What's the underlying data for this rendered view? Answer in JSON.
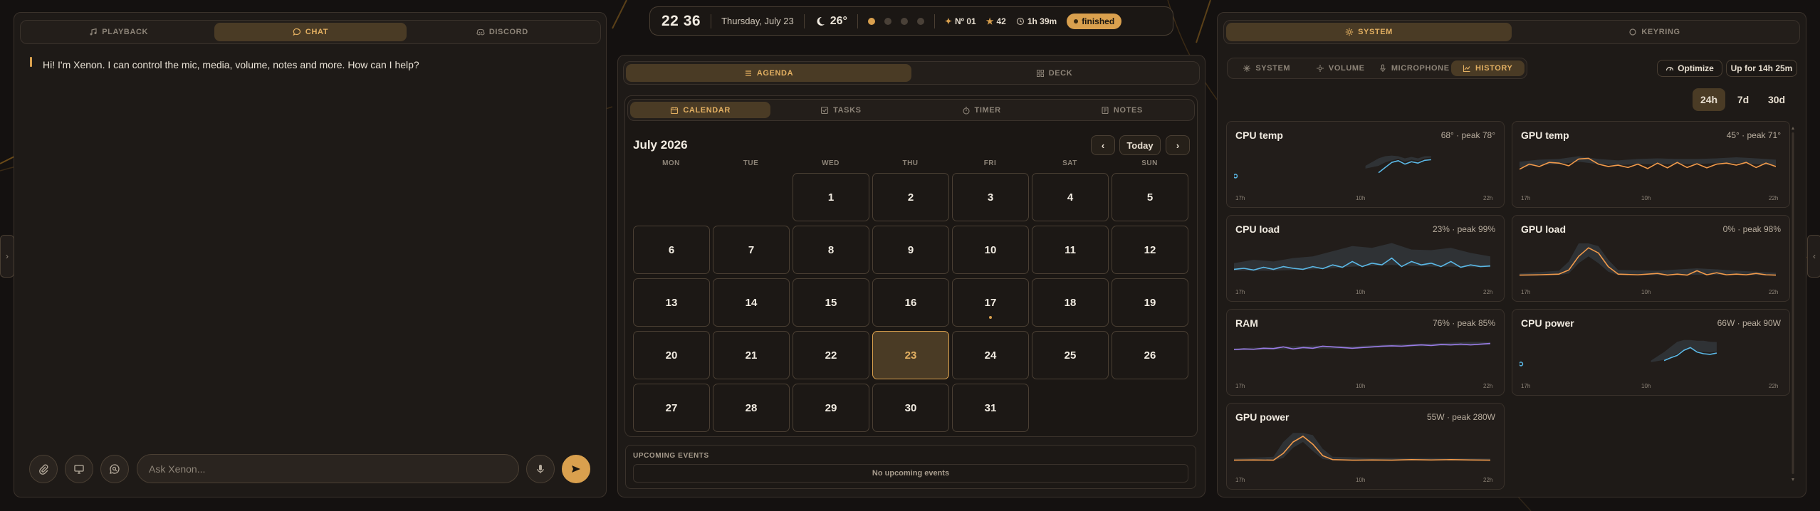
{
  "topbar": {
    "time": "22 36",
    "date": "Thursday, July 23",
    "weather_icon": "moon-icon",
    "temperature": "26°",
    "dots": [
      true,
      false,
      false,
      false
    ],
    "rank_label": "Nº 01",
    "stars_label": "42",
    "timer_label": "1h 39m",
    "status_label": "finished"
  },
  "chat_panel": {
    "tabs": [
      {
        "label": "PLAYBACK",
        "icon": "music-icon",
        "active": false
      },
      {
        "label": "CHAT",
        "icon": "chat-icon",
        "active": true
      },
      {
        "label": "DISCORD",
        "icon": "discord-icon",
        "active": false
      }
    ],
    "message": "Hi! I'm Xenon. I can control the mic, media, volume, notes and more. How can I help?",
    "input_placeholder": "Ask Xenon..."
  },
  "agenda_panel": {
    "tabs": [
      {
        "label": "AGENDA",
        "icon": "list-icon",
        "active": true
      },
      {
        "label": "DECK",
        "icon": "grid-icon",
        "active": false
      }
    ],
    "subtabs": [
      {
        "label": "CALENDAR",
        "icon": "calendar-icon",
        "active": true
      },
      {
        "label": "TASKS",
        "icon": "check-square-icon",
        "active": false
      },
      {
        "label": "TIMER",
        "icon": "stopwatch-icon",
        "active": false
      },
      {
        "label": "NOTES",
        "icon": "notes-icon",
        "active": false
      }
    ],
    "calendar": {
      "month_label": "July 2026",
      "today_button": "Today",
      "weekdays": [
        "MON",
        "TUE",
        "WED",
        "THU",
        "FRI",
        "SAT",
        "SUN"
      ],
      "first_weekday_index": 2,
      "days_in_month": 31,
      "today": 23,
      "event_days": [
        17
      ]
    },
    "upcoming": {
      "header": "UPCOMING EVENTS",
      "empty_text": "No upcoming events"
    }
  },
  "system_panel": {
    "tabs": [
      {
        "label": "SYSTEM",
        "icon": "gear-icon",
        "active": true
      },
      {
        "label": "KEYRING",
        "icon": "keyring-icon",
        "active": false
      }
    ],
    "subtabs": [
      {
        "label": "SYSTEM",
        "icon": "sparkle-icon",
        "active": false
      },
      {
        "label": "VOLUME",
        "icon": "volume-icon",
        "active": false
      },
      {
        "label": "MICROPHONE",
        "icon": "mic-icon",
        "active": false
      },
      {
        "label": "HISTORY",
        "icon": "chart-icon",
        "active": true
      }
    ],
    "optimize_label": "Optimize",
    "uptime_label": "Up for 14h 25m",
    "ranges": [
      {
        "label": "24h",
        "active": true
      },
      {
        "label": "7d",
        "active": false
      },
      {
        "label": "30d",
        "active": false
      }
    ],
    "accent": "#d9a04e",
    "series_colors": {
      "blue": "#5bb8e6",
      "orange": "#f29a4a",
      "purple": "#9b7be6"
    }
  },
  "chart_data": [
    {
      "type": "area",
      "title": "CPU temp",
      "summary": "68° · peak 78°",
      "color": "#5bb8e6",
      "xticks": [
        "17h",
        "10h",
        "22h"
      ],
      "ylim": [
        0,
        100
      ],
      "values": [
        null,
        null,
        null,
        null,
        null,
        null,
        null,
        null,
        null,
        null,
        null,
        null,
        null,
        null,
        null,
        null,
        null,
        null,
        null,
        null,
        null,
        null,
        null,
        null,
        null,
        null,
        null,
        null,
        null,
        null,
        null,
        null,
        null,
        null,
        null,
        null,
        null,
        null,
        null,
        null,
        null,
        null,
        null,
        null,
        null,
        null,
        null,
        null,
        null,
        null,
        null
      ],
      "line": [
        [
          0,
          20
        ],
        [
          40,
          null
        ],
        [
          44,
          30
        ],
        [
          46,
          45
        ],
        [
          48,
          60
        ],
        [
          50,
          65
        ],
        [
          52,
          55
        ],
        [
          54,
          62
        ],
        [
          56,
          58
        ],
        [
          58,
          66
        ],
        [
          60,
          68
        ]
      ],
      "band": [
        [
          40,
          42,
          50
        ],
        [
          44,
          50,
          72
        ],
        [
          46,
          60,
          78
        ],
        [
          48,
          66,
          80
        ],
        [
          50,
          70,
          78
        ],
        [
          52,
          62,
          72
        ],
        [
          54,
          68,
          76
        ],
        [
          56,
          64,
          72
        ],
        [
          58,
          72,
          78
        ],
        [
          60,
          74,
          78
        ]
      ]
    },
    {
      "type": "area",
      "title": "GPU temp",
      "summary": "45° · peak 71°",
      "color": "#f29a4a",
      "xticks": [
        "17h",
        "10h",
        "22h"
      ],
      "ylim": [
        0,
        100
      ],
      "line": [
        [
          0,
          40
        ],
        [
          3,
          55
        ],
        [
          6,
          48
        ],
        [
          9,
          60
        ],
        [
          12,
          58
        ],
        [
          15,
          50
        ],
        [
          18,
          70
        ],
        [
          21,
          72
        ],
        [
          24,
          55
        ],
        [
          27,
          48
        ],
        [
          30,
          52
        ],
        [
          33,
          45
        ],
        [
          36,
          55
        ],
        [
          39,
          42
        ],
        [
          42,
          58
        ],
        [
          45,
          44
        ],
        [
          48,
          60
        ],
        [
          51,
          45
        ],
        [
          54,
          56
        ],
        [
          57,
          44
        ],
        [
          60,
          55
        ],
        [
          63,
          58
        ],
        [
          66,
          52
        ],
        [
          69,
          60
        ],
        [
          72,
          45
        ],
        [
          75,
          58
        ],
        [
          78,
          48
        ]
      ],
      "band": [
        [
          0,
          45,
          62
        ],
        [
          6,
          52,
          68
        ],
        [
          12,
          55,
          70
        ],
        [
          18,
          62,
          78
        ],
        [
          24,
          55,
          70
        ],
        [
          30,
          52,
          66
        ],
        [
          36,
          55,
          70
        ],
        [
          42,
          55,
          72
        ],
        [
          48,
          55,
          70
        ],
        [
          54,
          55,
          70
        ],
        [
          60,
          58,
          72
        ],
        [
          66,
          58,
          75
        ],
        [
          72,
          55,
          72
        ],
        [
          78,
          50,
          68
        ]
      ]
    },
    {
      "type": "area",
      "title": "CPU load",
      "summary": "23% · peak 99%",
      "color": "#5bb8e6",
      "xticks": [
        "17h",
        "10h",
        "22h"
      ],
      "ylim": [
        0,
        100
      ],
      "line": [
        [
          0,
          22
        ],
        [
          3,
          25
        ],
        [
          6,
          20
        ],
        [
          9,
          28
        ],
        [
          12,
          22
        ],
        [
          15,
          30
        ],
        [
          18,
          25
        ],
        [
          21,
          22
        ],
        [
          24,
          30
        ],
        [
          27,
          24
        ],
        [
          30,
          35
        ],
        [
          33,
          28
        ],
        [
          36,
          45
        ],
        [
          39,
          30
        ],
        [
          42,
          40
        ],
        [
          45,
          35
        ],
        [
          48,
          55
        ],
        [
          51,
          30
        ],
        [
          54,
          45
        ],
        [
          57,
          35
        ],
        [
          60,
          40
        ],
        [
          63,
          30
        ],
        [
          66,
          45
        ],
        [
          69,
          28
        ],
        [
          72,
          35
        ],
        [
          75,
          30
        ],
        [
          78,
          32
        ]
      ],
      "band": [
        [
          0,
          18,
          40
        ],
        [
          6,
          18,
          50
        ],
        [
          12,
          18,
          45
        ],
        [
          18,
          20,
          55
        ],
        [
          24,
          22,
          60
        ],
        [
          30,
          25,
          75
        ],
        [
          36,
          30,
          90
        ],
        [
          42,
          32,
          85
        ],
        [
          48,
          35,
          99
        ],
        [
          54,
          32,
          80
        ],
        [
          60,
          30,
          78
        ],
        [
          66,
          30,
          85
        ],
        [
          72,
          28,
          70
        ],
        [
          78,
          28,
          60
        ]
      ]
    },
    {
      "type": "area",
      "title": "GPU load",
      "summary": "0% · peak 98%",
      "color": "#f29a4a",
      "xticks": [
        "17h",
        "10h",
        "22h"
      ],
      "ylim": [
        0,
        100
      ],
      "line": [
        [
          0,
          5
        ],
        [
          6,
          6
        ],
        [
          12,
          8
        ],
        [
          15,
          20
        ],
        [
          18,
          60
        ],
        [
          21,
          85
        ],
        [
          24,
          70
        ],
        [
          27,
          30
        ],
        [
          30,
          8
        ],
        [
          36,
          6
        ],
        [
          42,
          10
        ],
        [
          45,
          5
        ],
        [
          48,
          8
        ],
        [
          51,
          5
        ],
        [
          54,
          18
        ],
        [
          57,
          6
        ],
        [
          60,
          12
        ],
        [
          63,
          6
        ],
        [
          66,
          8
        ],
        [
          69,
          6
        ],
        [
          72,
          10
        ],
        [
          75,
          6
        ],
        [
          78,
          5
        ]
      ],
      "band": [
        [
          0,
          3,
          10
        ],
        [
          12,
          5,
          18
        ],
        [
          15,
          10,
          45
        ],
        [
          18,
          40,
          98
        ],
        [
          21,
          60,
          98
        ],
        [
          24,
          40,
          90
        ],
        [
          27,
          15,
          50
        ],
        [
          30,
          5,
          20
        ],
        [
          42,
          5,
          18
        ],
        [
          54,
          6,
          25
        ],
        [
          60,
          6,
          22
        ],
        [
          66,
          6,
          18
        ],
        [
          78,
          4,
          12
        ]
      ]
    },
    {
      "type": "area",
      "title": "RAM",
      "summary": "76% · peak 85%",
      "color": "#9b7be6",
      "xticks": [
        "17h",
        "10h",
        "22h"
      ],
      "ylim": [
        0,
        100
      ],
      "line": [
        [
          0,
          62
        ],
        [
          3,
          64
        ],
        [
          6,
          63
        ],
        [
          9,
          66
        ],
        [
          12,
          65
        ],
        [
          15,
          70
        ],
        [
          18,
          64
        ],
        [
          21,
          68
        ],
        [
          24,
          66
        ],
        [
          27,
          72
        ],
        [
          30,
          70
        ],
        [
          33,
          68
        ],
        [
          36,
          66
        ],
        [
          39,
          68
        ],
        [
          42,
          70
        ],
        [
          45,
          72
        ],
        [
          48,
          73
        ],
        [
          51,
          72
        ],
        [
          54,
          74
        ],
        [
          57,
          76
        ],
        [
          60,
          74
        ],
        [
          63,
          77
        ],
        [
          66,
          76
        ],
        [
          69,
          78
        ],
        [
          72,
          76
        ],
        [
          75,
          78
        ],
        [
          78,
          80
        ]
      ],
      "band": [
        [
          0,
          60,
          66
        ],
        [
          12,
          62,
          70
        ],
        [
          24,
          64,
          74
        ],
        [
          36,
          64,
          72
        ],
        [
          48,
          70,
          78
        ],
        [
          60,
          72,
          80
        ],
        [
          72,
          74,
          85
        ],
        [
          78,
          76,
          84
        ]
      ]
    },
    {
      "type": "area",
      "title": "CPU power",
      "summary": "66W · peak 90W",
      "color": "#5bb8e6",
      "xticks": [
        "17h",
        "10h",
        "22h"
      ],
      "ylim": [
        0,
        100
      ],
      "line": [
        [
          0,
          20
        ],
        [
          40,
          null
        ],
        [
          44,
          30
        ],
        [
          46,
          38
        ],
        [
          48,
          45
        ],
        [
          50,
          60
        ],
        [
          52,
          68
        ],
        [
          54,
          55
        ],
        [
          56,
          50
        ],
        [
          58,
          48
        ],
        [
          60,
          52
        ]
      ],
      "band": [
        [
          40,
          25,
          30
        ],
        [
          44,
          32,
          55
        ],
        [
          46,
          40,
          70
        ],
        [
          48,
          50,
          85
        ],
        [
          50,
          62,
          90
        ],
        [
          52,
          66,
          90
        ],
        [
          54,
          58,
          88
        ],
        [
          56,
          55,
          88
        ],
        [
          58,
          54,
          85
        ],
        [
          60,
          56,
          84
        ]
      ]
    },
    {
      "type": "area",
      "title": "GPU power",
      "summary": "55W · peak 280W",
      "color": "#f29a4a",
      "xticks": [
        "17h",
        "10h",
        "22h"
      ],
      "ylim": [
        0,
        300
      ],
      "line": [
        [
          0,
          40
        ],
        [
          6,
          42
        ],
        [
          12,
          40
        ],
        [
          15,
          100
        ],
        [
          18,
          200
        ],
        [
          21,
          250
        ],
        [
          24,
          180
        ],
        [
          27,
          80
        ],
        [
          30,
          45
        ],
        [
          36,
          40
        ],
        [
          42,
          42
        ],
        [
          48,
          40
        ],
        [
          54,
          45
        ],
        [
          60,
          42
        ],
        [
          66,
          45
        ],
        [
          72,
          42
        ],
        [
          78,
          40
        ]
      ],
      "band": [
        [
          0,
          35,
          55
        ],
        [
          12,
          35,
          70
        ],
        [
          15,
          60,
          200
        ],
        [
          18,
          150,
          280
        ],
        [
          21,
          200,
          280
        ],
        [
          24,
          120,
          260
        ],
        [
          27,
          50,
          140
        ],
        [
          30,
          38,
          70
        ],
        [
          42,
          35,
          60
        ],
        [
          60,
          38,
          60
        ],
        [
          78,
          35,
          55
        ]
      ]
    }
  ]
}
